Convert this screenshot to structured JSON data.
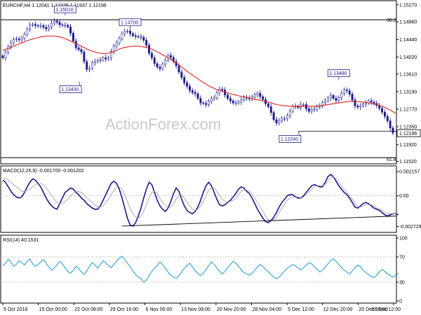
{
  "chart_data": [
    {
      "type": "candlestick",
      "panel": "price",
      "title": "EURCHF,H4  1.12041 1.12225 1.11937 1.12196",
      "price_ticks": [
        1.1527,
        1.1486,
        1.1444,
        1.1402,
        1.1361,
        1.1319,
        1.1277,
        1.1235,
        1.1192,
        1.1152
      ],
      "price_tick_labels": [
        "1.15270",
        "1.14860",
        "1.14440",
        "1.14020",
        "1.13610",
        "1.13190",
        "1.12770",
        "1.12350",
        "1.11920",
        "1.11520"
      ],
      "ylim": [
        1.1148,
        1.1535
      ],
      "current_price": 1.12196,
      "current_price_label": "1.12196",
      "fib_levels": [
        {
          "label": "38.2",
          "value": 1.1491
        },
        {
          "label": "61.8",
          "value": 1.1161
        }
      ],
      "support_level": 1.1224,
      "annotations": [
        {
          "label": "1.15010",
          "value": 1.1501,
          "index": 23
        },
        {
          "label": "1.14700",
          "value": 1.147,
          "index": 47
        },
        {
          "label": "1.13430",
          "value": 1.1343,
          "index": 28
        },
        {
          "label": "1.12240",
          "value": 1.1224,
          "index": 109
        },
        {
          "label": "1.13480",
          "value": 1.1348,
          "index": 124
        }
      ],
      "close": [
        1.14,
        1.1413,
        1.1427,
        1.1436,
        1.1444,
        1.1445,
        1.1443,
        1.1447,
        1.1456,
        1.1469,
        1.1478,
        1.148,
        1.1477,
        1.1476,
        1.1477,
        1.1473,
        1.1469,
        1.1474,
        1.1483,
        1.1488,
        1.1485,
        1.1479,
        1.1478,
        1.1478,
        1.1474,
        1.1459,
        1.144,
        1.1424,
        1.142,
        1.1414,
        1.1391,
        1.1372,
        1.1375,
        1.1388,
        1.1391,
        1.1394,
        1.1395,
        1.14,
        1.1397,
        1.14,
        1.1415,
        1.1428,
        1.1436,
        1.1446,
        1.1458,
        1.1463,
        1.1464,
        1.1458,
        1.1453,
        1.1451,
        1.145,
        1.1449,
        1.1442,
        1.143,
        1.1411,
        1.14,
        1.1386,
        1.1378,
        1.1374,
        1.1385,
        1.1394,
        1.1406,
        1.1401,
        1.1391,
        1.1381,
        1.1366,
        1.1353,
        1.134,
        1.1332,
        1.1322,
        1.1317,
        1.1314,
        1.1303,
        1.1292,
        1.1291,
        1.1288,
        1.1296,
        1.1302,
        1.1305,
        1.1316,
        1.1325,
        1.1323,
        1.1311,
        1.1303,
        1.1297,
        1.1292,
        1.1292,
        1.1294,
        1.13,
        1.1305,
        1.1304,
        1.1302,
        1.1306,
        1.1311,
        1.1315,
        1.1307,
        1.13,
        1.129,
        1.1283,
        1.1269,
        1.1252,
        1.1244,
        1.125,
        1.1254,
        1.1254,
        1.1262,
        1.1272,
        1.1284,
        1.1284,
        1.1281,
        1.1288,
        1.1288,
        1.1278,
        1.1272,
        1.1276,
        1.1277,
        1.1283,
        1.1285,
        1.1293,
        1.1297,
        1.1304,
        1.131,
        1.1303,
        1.1298,
        1.1305,
        1.1315,
        1.1323,
        1.1321,
        1.1313,
        1.1299,
        1.1285,
        1.1282,
        1.1285,
        1.1289,
        1.1292,
        1.1297,
        1.1294,
        1.1291,
        1.1286,
        1.1279,
        1.127,
        1.126,
        1.1249,
        1.1232,
        1.122
      ],
      "ma": [
        1.1418,
        1.142,
        1.1422,
        1.1425,
        1.1428,
        1.1431,
        1.1433,
        1.1436,
        1.1438,
        1.1441,
        1.1443,
        1.1445,
        1.1447,
        1.1448,
        1.145,
        1.1451,
        1.1452,
        1.1452,
        1.1452,
        1.1452,
        1.1451,
        1.145,
        1.1448,
        1.1446,
        1.1443,
        1.144,
        1.1437,
        1.1434,
        1.1431,
        1.1428,
        1.1425,
        1.1421,
        1.1418,
        1.1416,
        1.1414,
        1.1412,
        1.1411,
        1.141,
        1.141,
        1.1411,
        1.1413,
        1.1415,
        1.1418,
        1.1421,
        1.1423,
        1.1425,
        1.1426,
        1.1427,
        1.1428,
        1.1428,
        1.1428,
        1.1427,
        1.1426,
        1.1425,
        1.1423,
        1.1421,
        1.1418,
        1.1414,
        1.1411,
        1.1407,
        1.1404,
        1.14,
        1.1396,
        1.1392,
        1.1387,
        1.1383,
        1.1378,
        1.1373,
        1.1368,
        1.1363,
        1.1359,
        1.1354,
        1.135,
        1.1345,
        1.1341,
        1.1337,
        1.1333,
        1.133,
        1.1327,
        1.1324,
        1.1322,
        1.132,
        1.1318,
        1.1316,
        1.1314,
        1.1312,
        1.1311,
        1.1309,
        1.1308,
        1.1307,
        1.1305,
        1.1304,
        1.1302,
        1.1301,
        1.13,
        1.1298,
        1.1297,
        1.1295,
        1.1294,
        1.1292,
        1.129,
        1.1288,
        1.1287,
        1.1286,
        1.1285,
        1.1285,
        1.1284,
        1.1284,
        1.1284,
        1.1284,
        1.1284,
        1.1284,
        1.1284,
        1.1284,
        1.1284,
        1.1284,
        1.1284,
        1.1285,
        1.1286,
        1.1287,
        1.1288,
        1.1289,
        1.129,
        1.1291,
        1.1292,
        1.1293,
        1.1294,
        1.1295,
        1.1296,
        1.1296,
        1.1296,
        1.1295,
        1.1295,
        1.1294,
        1.1293,
        1.1292,
        1.1291,
        1.129,
        1.1288,
        1.1286,
        1.1284,
        1.1281,
        1.1278,
        1.1275,
        1.1271,
        1.1267
      ]
    },
    {
      "type": "line",
      "panel": "macd",
      "label": "MACD(12,26,9) -0.001709 -0.001202",
      "yticks": [
        0.002157,
        0.0,
        -0.002729
      ],
      "ytick_labels": [
        "0.002157",
        "0.00",
        "-0.002729"
      ],
      "ylim": [
        -0.0032,
        0.0026
      ],
      "trendline": {
        "from": [
          44,
          -0.0027
        ],
        "to": [
          149,
          -0.00193
        ]
      },
      "series": [
        {
          "name": "MACD",
          "values": [
            0.0014,
            0.0012,
            0.0008,
            0.0004,
            0.0001,
            -0.0001,
            -0.0002,
            -0.0001,
            0.0003,
            0.0008,
            0.0012,
            0.0015,
            0.0014,
            0.0011,
            0.0008,
            0.0003,
            -0.0002,
            -0.0006,
            -0.0009,
            -0.0011,
            -0.0012,
            -0.0007,
            -0.0002,
            0.0003,
            0.0005,
            0.0007,
            0.0006,
            0.0003,
            0.0001,
            -0.0002,
            -0.0004,
            -0.0007,
            -0.0009,
            -0.0011,
            -0.0012,
            -0.0012,
            -0.0009,
            -0.0004,
            0.0001,
            0.0006,
            0.0011,
            0.0013,
            0.0011,
            0.0006,
            -0.0002,
            -0.0011,
            -0.002,
            -0.0026,
            -0.0027,
            -0.0024,
            -0.0018,
            -0.0011,
            -0.0002,
            0.0006,
            0.0012,
            0.001,
            0.0003,
            -0.0004,
            -0.0009,
            -0.0012,
            -0.0014,
            -0.0011,
            -0.0005,
            0.0002,
            0.0007,
            0.0004,
            -0.0003,
            -0.0009,
            -0.0013,
            -0.0015,
            -0.0016,
            -0.0014,
            -0.001,
            -0.0004,
            0.0003,
            0.0009,
            0.0012,
            0.0009,
            0.0003,
            -0.0003,
            -0.0008,
            -0.0009,
            -0.0008,
            -0.0006,
            -0.0004,
            -0.0001,
            0.0002,
            0.0006,
            0.0008,
            0.0007,
            0.0004,
            0.0002,
            -0.0002,
            -0.0007,
            -0.0012,
            -0.0016,
            -0.002,
            -0.0023,
            -0.0024,
            -0.0022,
            -0.0019,
            -0.0015,
            -0.001,
            -0.0006,
            -0.0003,
            0.0,
            0.0001,
            0.0001,
            -0.0001,
            -0.0002,
            -0.0002,
            0.0,
            0.0003,
            0.0006,
            0.0009,
            0.001,
            0.0009,
            0.0008,
            0.0008,
            0.0012,
            0.0017,
            0.0019,
            0.0017,
            0.0013,
            0.0009,
            0.0006,
            0.0003,
            0.0001,
            -0.0002,
            -0.0006,
            -0.001,
            -0.0011,
            -0.0009,
            -0.0007,
            -0.0006,
            -0.0007,
            -0.0009,
            -0.0011,
            -0.0012,
            -0.0013,
            -0.0015,
            -0.0017,
            -0.0018,
            -0.0017,
            -0.0016,
            -0.0016,
            -0.0017
          ]
        },
        {
          "name": "Signal",
          "values": [
            0.0016,
            0.0015,
            0.0014,
            0.0012,
            0.001,
            0.0008,
            0.0006,
            0.0004,
            0.0004,
            0.0005,
            0.0006,
            0.0008,
            0.001,
            0.0011,
            0.0011,
            0.001,
            0.0007,
            0.0004,
            0.0,
            -0.0003,
            -0.0006,
            -0.0007,
            -0.0007,
            -0.0005,
            -0.0003,
            0.0,
            0.0002,
            0.0004,
            0.0004,
            0.0003,
            0.0001,
            -0.0002,
            -0.0004,
            -0.0006,
            -0.0008,
            -0.001,
            -0.001,
            -0.0009,
            -0.0006,
            -0.0003,
            0.0001,
            0.0005,
            0.0008,
            0.0008,
            0.0006,
            0.0001,
            -0.0005,
            -0.0011,
            -0.0016,
            -0.0019,
            -0.002,
            -0.0018,
            -0.0014,
            -0.0008,
            -0.0002,
            0.0003,
            0.0004,
            0.0002,
            -0.0002,
            -0.0006,
            -0.0009,
            -0.0011,
            -0.001,
            -0.0007,
            -0.0003,
            0.0,
            0.0001,
            -0.0002,
            -0.0006,
            -0.0009,
            -0.0012,
            -0.0013,
            -0.0012,
            -0.0009,
            -0.0005,
            0.0,
            0.0005,
            0.0007,
            0.0007,
            0.0004,
            0.0,
            -0.0003,
            -0.0005,
            -0.0006,
            -0.0005,
            -0.0004,
            -0.0002,
            0.0001,
            0.0004,
            0.0005,
            0.0005,
            0.0004,
            0.0002,
            -0.0002,
            -0.0006,
            -0.001,
            -0.0014,
            -0.0018,
            -0.0021,
            -0.0022,
            -0.0021,
            -0.0019,
            -0.0015,
            -0.0011,
            -0.0007,
            -0.0004,
            -0.0002,
            -0.0001,
            -0.0001,
            -0.0001,
            -0.0002,
            -0.0001,
            0.0001,
            0.0003,
            0.0006,
            0.0008,
            0.0009,
            0.0009,
            0.0009,
            0.001,
            0.0013,
            0.0016,
            0.0017,
            0.0015,
            0.0012,
            0.0009,
            0.0006,
            0.0003,
            0.0,
            -0.0003,
            -0.0007,
            -0.0009,
            -0.001,
            -0.0009,
            -0.0008,
            -0.0008,
            -0.0008,
            -0.0009,
            -0.0011,
            -0.0012,
            -0.0013,
            -0.0015,
            -0.0016,
            -0.0016,
            -0.0016,
            -0.0016,
            -0.0016
          ]
        }
      ]
    },
    {
      "type": "line",
      "panel": "rsi",
      "label": "RSI(14) 40.1531",
      "yticks": [
        100,
        70,
        30,
        0
      ],
      "ytick_labels": [
        "100",
        "70",
        "30",
        "0"
      ],
      "ylim": [
        0,
        100
      ],
      "series": [
        {
          "name": "RSI",
          "values": [
            56,
            60,
            66,
            62,
            55,
            58,
            64,
            61,
            57,
            63,
            67,
            59,
            55,
            58,
            62,
            66,
            60,
            54,
            49,
            52,
            58,
            63,
            59,
            52,
            47,
            44,
            49,
            55,
            52,
            46,
            42,
            48,
            55,
            61,
            57,
            52,
            58,
            64,
            61,
            56,
            53,
            58,
            63,
            68,
            71,
            66,
            60,
            54,
            48,
            42,
            38,
            35,
            30,
            33,
            40,
            47,
            52,
            56,
            62,
            58,
            52,
            46,
            41,
            38,
            36,
            40,
            46,
            52,
            56,
            60,
            54,
            48,
            44,
            40,
            44,
            50,
            56,
            62,
            58,
            52,
            47,
            43,
            47,
            53,
            58,
            63,
            60,
            55,
            50,
            45,
            43,
            41,
            44,
            49,
            54,
            58,
            55,
            50,
            46,
            42,
            38,
            35,
            38,
            43,
            48,
            52,
            55,
            58,
            56,
            52,
            49,
            53,
            57,
            61,
            59,
            55,
            50,
            46,
            49,
            54,
            59,
            64,
            67,
            63,
            58,
            53,
            49,
            46,
            43,
            48,
            53,
            57,
            54,
            49,
            45,
            42,
            39,
            37,
            41,
            46,
            50,
            47,
            43,
            40,
            38,
            41,
            44
          ]
        }
      ]
    },
    {
      "type": "axis",
      "panel": "time",
      "date_labels": [
        "5 Oct 2018",
        "15 Oct 00:00",
        "22 Oct 08:00",
        "29 Oct 16:00",
        "6 Nov 00:00",
        "13 Nov 08:00",
        "20 Nov 20:00",
        "28 Nov 04:00",
        "5 Dec 12:00",
        "12 Dec 20:00",
        "20 Dec 04:00",
        "28 Dec 12:00"
      ]
    }
  ],
  "watermark": "ActionForex.com"
}
